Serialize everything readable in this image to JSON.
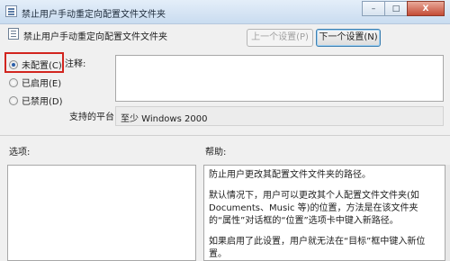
{
  "window": {
    "title": "禁止用户手动重定向配置文件文件夹",
    "buttons": {
      "minimize": "–",
      "maximize": "□",
      "close": "X"
    }
  },
  "header": {
    "setting_name": "禁止用户手动重定向配置文件文件夹",
    "prev_button": "上一个设置(P)",
    "next_button": "下一个设置(N)"
  },
  "state": {
    "options": [
      {
        "label": "未配置(C)",
        "checked": true
      },
      {
        "label": "已启用(E)",
        "checked": false
      },
      {
        "label": "已禁用(D)",
        "checked": false
      }
    ]
  },
  "comment": {
    "label": "注释:",
    "value": ""
  },
  "platform": {
    "label": "支持的平台:",
    "value": "至少 Windows 2000"
  },
  "options_section": {
    "label": "选项:"
  },
  "help_section": {
    "label": "帮助:",
    "paragraphs": [
      "防止用户更改其配置文件文件夹的路径。",
      "默认情况下，用户可以更改其个人配置文件文件夹(如 Documents、Music 等)的位置，方法是在该文件夹的“属性”对话框的“位置”选项卡中键入新路径。",
      "如果启用了此设置，用户就无法在“目标”框中键入新位置。"
    ]
  },
  "colors": {
    "highlight": "#d2251f",
    "accent": "#3c7fb1"
  }
}
